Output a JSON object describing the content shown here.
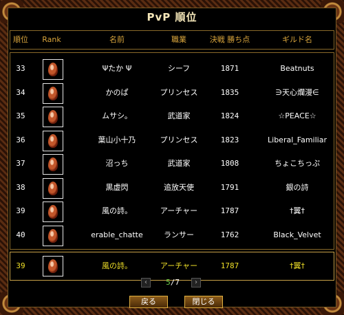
{
  "title": "PvP 順位",
  "headers": {
    "rank_num": "順位",
    "rank_icon": "Rank",
    "name": "名前",
    "job": "職業",
    "points": "決戦 勝ち点",
    "guild": "ギルド名"
  },
  "rows": [
    {
      "rank": "33",
      "name": "Ψたか Ψ",
      "job": "シーフ",
      "points": "1871",
      "guild": "Beatnuts"
    },
    {
      "rank": "34",
      "name": "かのぱ",
      "job": "プリンセス",
      "points": "1835",
      "guild": "∋天心爛漫∈"
    },
    {
      "rank": "35",
      "name": "ムサシ。",
      "job": "武道家",
      "points": "1824",
      "guild": "☆PEACE☆"
    },
    {
      "rank": "36",
      "name": "葉山小十乃",
      "job": "プリンセス",
      "points": "1823",
      "guild": "Liberal_Familiar"
    },
    {
      "rank": "37",
      "name": "沼っち",
      "job": "武道家",
      "points": "1808",
      "guild": "ちょこちっぷ"
    },
    {
      "rank": "38",
      "name": "黒虚閃",
      "job": "追放天使",
      "points": "1791",
      "guild": "銀の詩"
    },
    {
      "rank": "39",
      "name": "風の詩。",
      "job": "アーチャー",
      "points": "1787",
      "guild": "†翼†"
    },
    {
      "rank": "40",
      "name": "erable_chatte",
      "job": "ランサー",
      "points": "1762",
      "guild": "Black_Velvet"
    }
  ],
  "my_rank": {
    "rank": "39",
    "name": "風の詩。",
    "job": "アーチャー",
    "points": "1787",
    "guild": "†翼†"
  },
  "pager": {
    "prev": "‹",
    "current": "5",
    "separator": "/",
    "total": "7",
    "next": "›"
  },
  "buttons": {
    "back": "戻る",
    "close": "閉じる"
  },
  "colors": {
    "header_text": "#d9a53c",
    "highlight_text": "#f0e028",
    "page_current": "#6fd24a",
    "frame": "#5a2c12"
  }
}
